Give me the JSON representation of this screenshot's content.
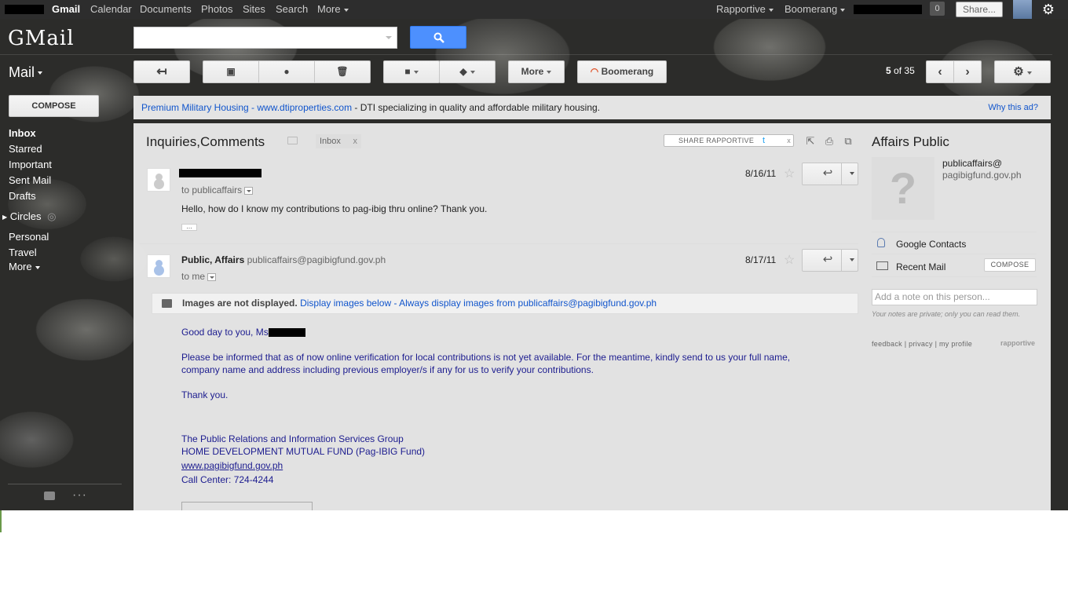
{
  "topbar": {
    "links": [
      "Gmail",
      "Calendar",
      "Documents",
      "Photos",
      "Sites",
      "Search",
      "More"
    ],
    "rapportive": "Rapportive",
    "boomerang": "Boomerang",
    "notifications": "0",
    "share": "Share..."
  },
  "header": {
    "logo": "GMail",
    "search_placeholder": "",
    "mail_label": "Mail"
  },
  "toolbar": {
    "more": "More",
    "boomerang": "Boomerang",
    "compose": "COMPOSE",
    "paging_current": "5",
    "paging_of": "of",
    "paging_total": "35"
  },
  "nav": {
    "items": [
      "Inbox",
      "Starred",
      "Important",
      "Sent Mail",
      "Drafts",
      "Circles",
      "Personal",
      "Travel",
      "More"
    ]
  },
  "ad": {
    "link_text": "Premium Military Housing",
    "sep": " - ",
    "domain": "www.dtiproperties.com",
    "desc": " - DTI specializing in quality and affordable military housing.",
    "why": "Why this ad?"
  },
  "thread": {
    "subject": "Inquiries,Comments",
    "inbox_tag": "Inbox",
    "tag_x": "x",
    "share_rapportive": "SHARE RAPPORTIVE",
    "share_close": "x",
    "messages": [
      {
        "to": "to publicaffairs",
        "date": "8/16/11",
        "snippet": "Hello, how do I know my contributions to pag-ibig thru online? Thank you."
      },
      {
        "sender": "Public, Affairs",
        "sender_email": "publicaffairs@pagibigfund.gov.ph",
        "to": "to me",
        "date": "8/17/11",
        "images_notice": "Images are not displayed.",
        "display_below": "Display images below",
        "images_sep": " - ",
        "always_display": "Always display images from publicaffairs@pagibigfund.gov.ph",
        "greeting": "Good day to you, Ms",
        "para1_line1": "Please be informed that as of now online verification for local contributions is not yet available.  For the meantime, kindly send to us your full name,",
        "para1_line2": "company name and address including previous employer/s if any for us to verify your contributions.",
        "thanks": "Thank you.",
        "sig1": "The Public Relations and Information Services Group",
        "sig2": "HOME DEVELOPMENT MUTUAL FUND (Pag-IBIG Fund)",
        "sig3": "www.pagibigfund.gov.ph",
        "sig4": "Call Center: 724-4244"
      }
    ]
  },
  "rapportive": {
    "name": "Affairs Public",
    "email_line1": "publicaffairs@",
    "email_line2": "pagibigfund.gov.ph",
    "google_contacts": "Google Contacts",
    "recent_mail": "Recent Mail",
    "compose": "COMPOSE",
    "note_placeholder": "Add a note on this person...",
    "private": "Your notes are private; only you can read them.",
    "links": "feedback | privacy | my profile",
    "logo": "rapportive"
  }
}
